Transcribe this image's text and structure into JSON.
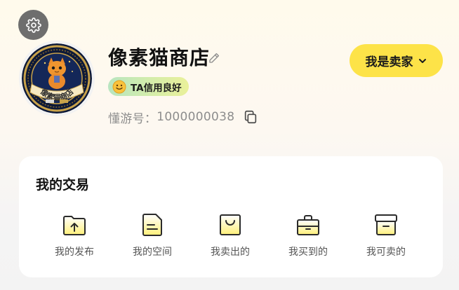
{
  "profile": {
    "shop_name": "像素猫商店",
    "credit_badge": "TA信用良好",
    "uid_label": "懂游号：",
    "uid_value": "1000000038",
    "avatar": {
      "ring_text": "像素猫商店",
      "icon": "cat-logo"
    }
  },
  "seller_button": {
    "label": "我是卖家",
    "icon": "chevron-down-icon"
  },
  "icons": {
    "settings": "gear-icon",
    "edit": "pencil-icon",
    "copy": "copy-icon",
    "credit": "smiley-icon"
  },
  "trades": {
    "title": "我的交易",
    "items": [
      {
        "label": "我的发布",
        "icon": "upload-folder-icon"
      },
      {
        "label": "我的空间",
        "icon": "document-icon"
      },
      {
        "label": "我卖出的",
        "icon": "shopping-bag-icon"
      },
      {
        "label": "我买到的",
        "icon": "shopping-basket-icon"
      },
      {
        "label": "我可卖的",
        "icon": "archive-box-icon"
      }
    ]
  },
  "colors": {
    "accent_yellow": "#fde348",
    "badge_green": "#b8e5c0",
    "icon_stroke": "#2b2b2b",
    "icon_fill_yellow": "#fff07a"
  }
}
